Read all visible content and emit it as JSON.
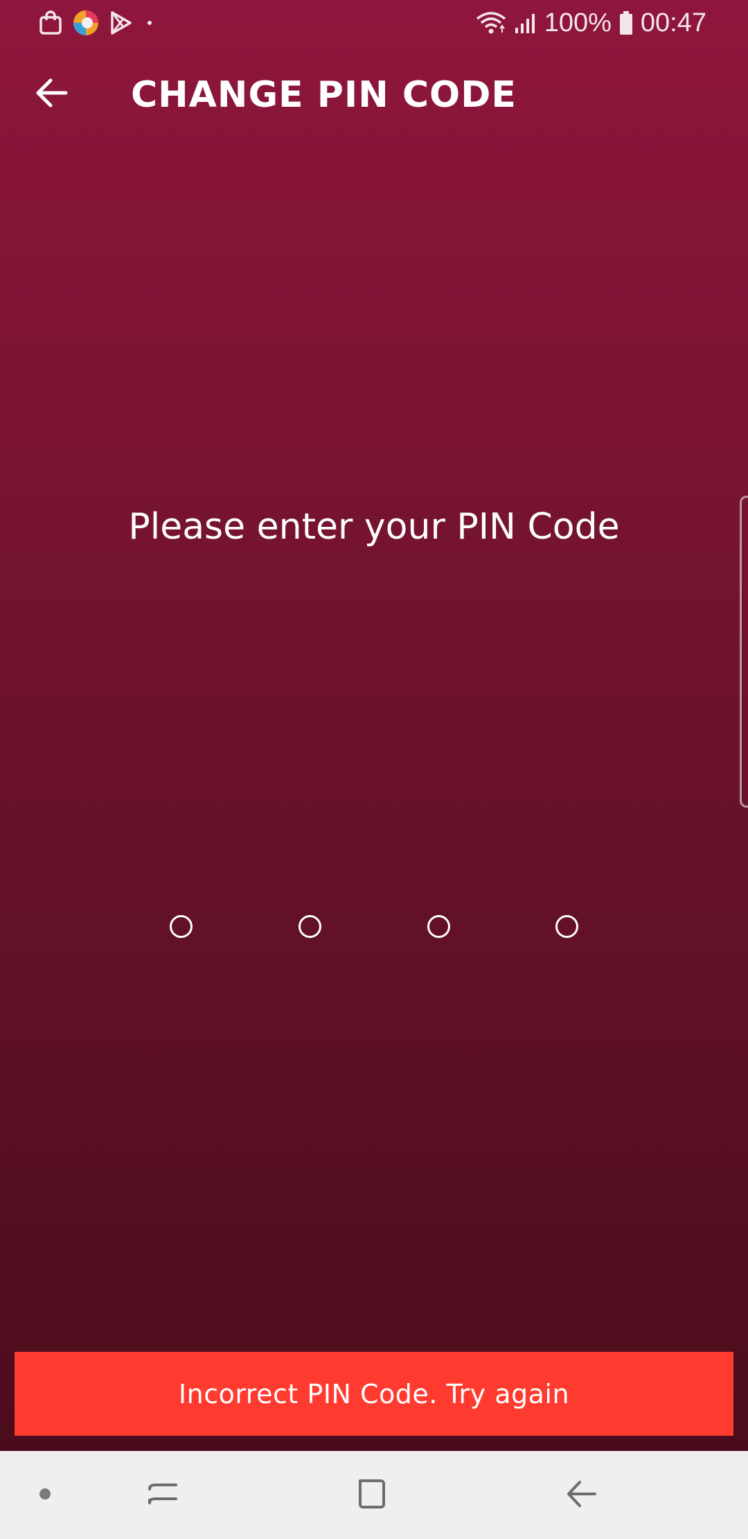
{
  "status_bar": {
    "left_icons": [
      "shopping-bag-icon",
      "browser-app-icon",
      "play-store-icon",
      "notification-dot-icon"
    ],
    "battery_percent": "100%",
    "time": "00:47",
    "right_icons": [
      "wifi-icon",
      "signal-icon",
      "battery-icon"
    ]
  },
  "toolbar": {
    "back_icon": "arrow-left-icon",
    "title": "CHANGE PIN CODE"
  },
  "main": {
    "prompt": "Please enter your PIN Code",
    "pin_length": 4,
    "pin_entered": 0
  },
  "toast": {
    "message": "Incorrect PIN Code. Try again",
    "color": "#ff3b30"
  },
  "nav_bar": {
    "items": [
      "dot-icon",
      "recents-icon",
      "home-icon",
      "back-icon"
    ]
  },
  "colors": {
    "background_top": "#8f163c",
    "background_bottom": "#4a0c1c",
    "nav_bar": "#efefef"
  }
}
